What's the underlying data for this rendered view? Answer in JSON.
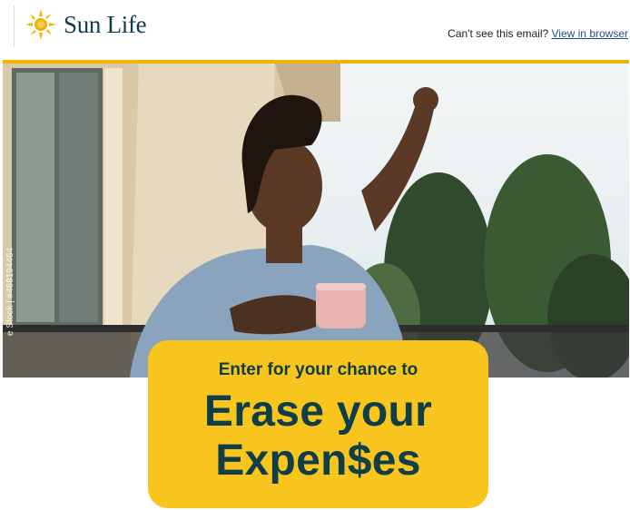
{
  "header": {
    "brand": "Sun Life",
    "cant_see_text": "Can't see this email?",
    "view_in_browser": "View in browser"
  },
  "hero": {
    "watermark": "e Stock | #468194464"
  },
  "promo": {
    "kicker": "Enter for your chance to",
    "headline_line1": "Erase your",
    "headline_line2": "Expen$es"
  },
  "colors": {
    "brand_navy": "#0f3d48",
    "brand_gold": "#f0b400",
    "promo_yellow": "#f7c51d",
    "link_blue": "#1f4f8a"
  },
  "icons": [
    "sun-logo-icon"
  ]
}
